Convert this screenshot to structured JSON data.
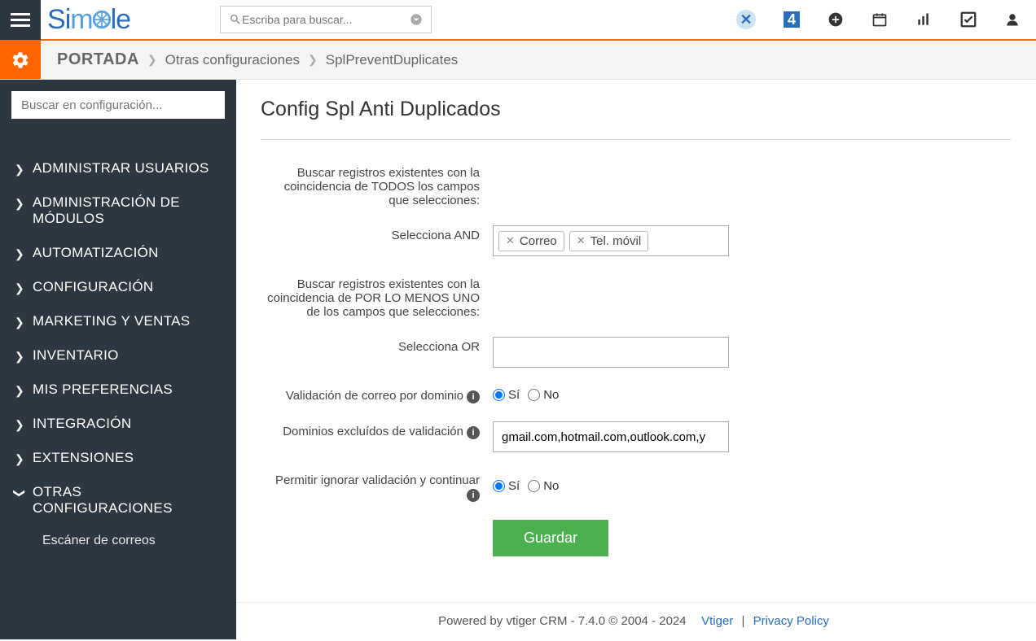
{
  "top": {
    "logo_text": "Simple",
    "search_placeholder": "Escriba para buscar...",
    "cal_badge": "4"
  },
  "breadcrumb": {
    "root": "PORTADA",
    "mid": "Otras configuraciones",
    "leaf": "SplPreventDuplicates"
  },
  "sidebar": {
    "search_placeholder": "Buscar en configuración...",
    "items": [
      "ADMINISTRAR USUARIOS",
      "ADMINISTRACIÓN DE MÓDULOS",
      "AUTOMATIZACIÓN",
      "CONFIGURACIÓN",
      "MARKETING Y VENTAS",
      "INVENTARIO",
      "MIS PREFERENCIAS",
      "INTEGRACIÓN",
      "EXTENSIONES",
      "OTRAS CONFIGURACIONES"
    ],
    "subitem": "Escáner de correos"
  },
  "page": {
    "title": "Config Spl Anti Duplicados",
    "label_and_desc": "Buscar registros existentes con la coincidencia de TODOS los campos que selecciones:",
    "label_and": "Selecciona AND",
    "and_tags": [
      "Correo",
      "Tel. móvil"
    ],
    "label_or_desc": "Buscar registros existentes con la coincidencia de POR LO MENOS UNO de los campos que selecciones:",
    "label_or": "Selecciona OR",
    "label_domain_validate": "Validación de correo por dominio",
    "label_domain_exclude": "Dominios excluídos de validación",
    "domain_exclude_value": "gmail.com,hotmail.com,outlook.com,y",
    "label_ignore": "Permitir ignorar validación y continuar",
    "yes": "Sí",
    "no": "No",
    "save": "Guardar"
  },
  "footer": {
    "text": "Powered by vtiger CRM - 7.4.0  © 2004 - 2024",
    "link1": "Vtiger",
    "sep": "|",
    "link2": "Privacy Policy"
  }
}
